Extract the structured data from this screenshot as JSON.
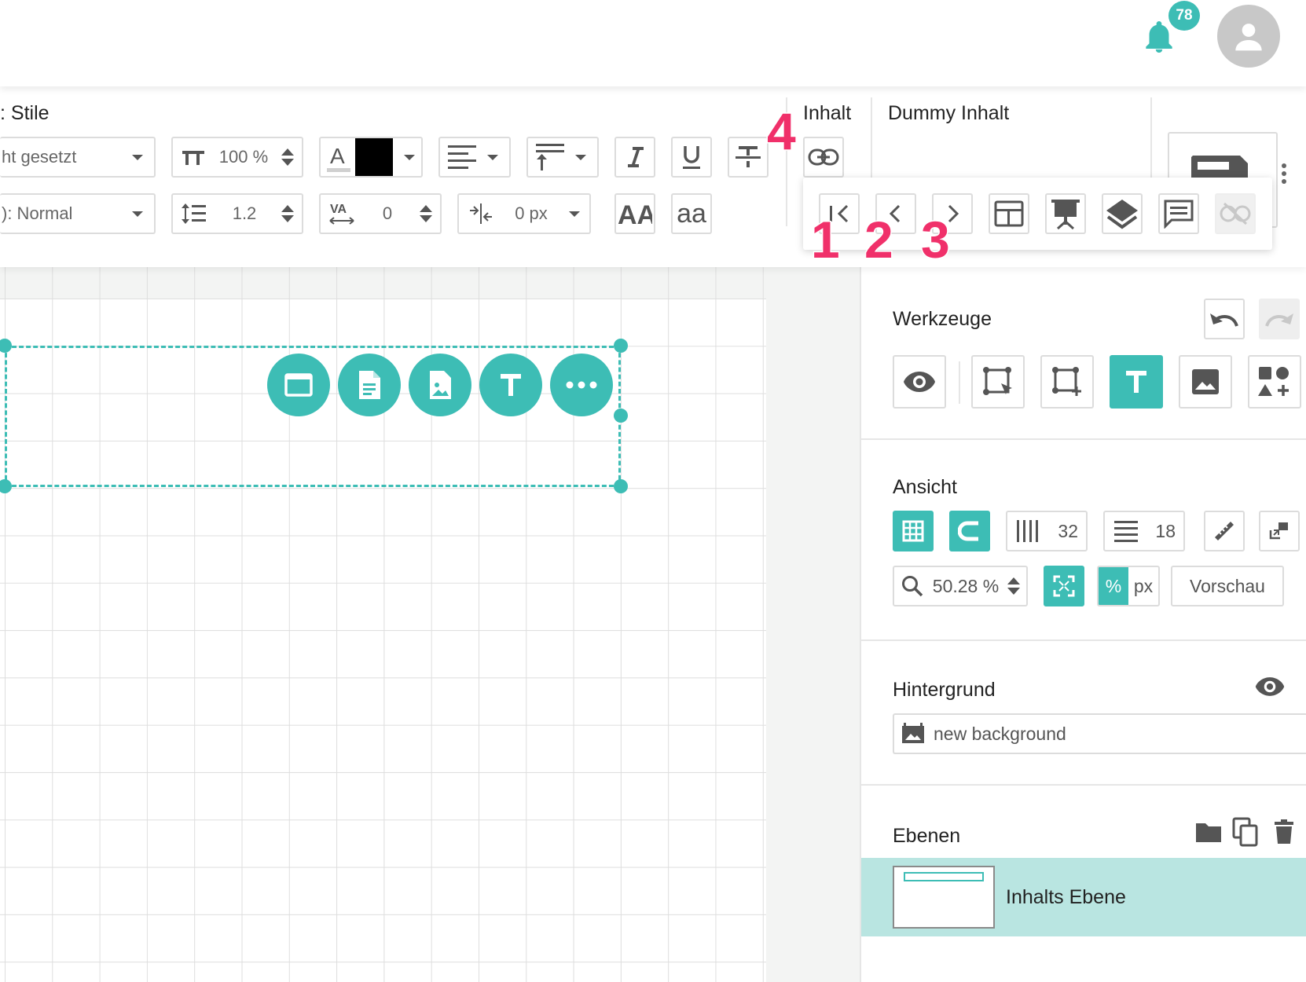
{
  "topbar": {
    "notification_count": "78"
  },
  "toolbar": {
    "styles_title": ": Stile",
    "font_select_value": "ht gesetzt",
    "font_size_value": "100 %",
    "paragraph_select_value": "): Normal",
    "line_height_value": "1.2",
    "letter_spacing_value": "0",
    "indent_value": "0 px",
    "text_color": "#000000",
    "aa_label": "aa",
    "content_title": "Inhalt",
    "dummy_title": "Dummy Inhalt"
  },
  "markers": [
    "1",
    "2",
    "3",
    "4"
  ],
  "canvas": {
    "accent_color": "#3dbdb5"
  },
  "panel": {
    "tools_title": "Werkzeuge",
    "view_title": "Ansicht",
    "columns_value": "32",
    "rows_value": "18",
    "zoom_value": "50.28 %",
    "unit_percent": "%",
    "unit_px": "px",
    "preview_label": "Vorschau",
    "background_title": "Hintergrund",
    "background_value": "new background",
    "layers_title": "Ebenen",
    "layer_name": "Inhalts Ebene"
  }
}
